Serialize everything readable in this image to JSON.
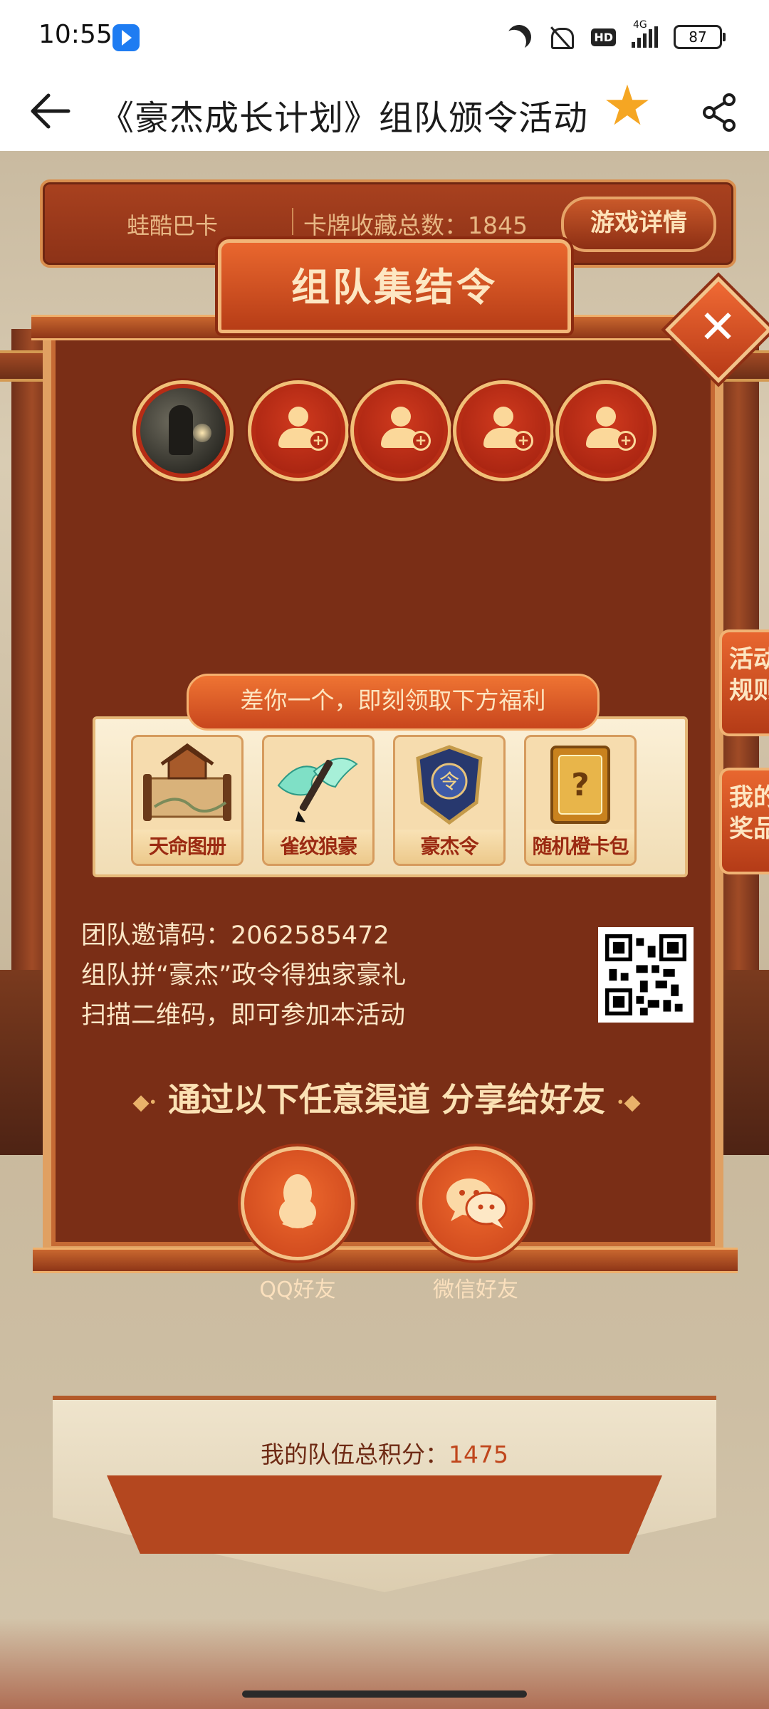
{
  "status_bar": {
    "time": "10:55",
    "network": "4G",
    "hd_badge": "HD",
    "battery": "87"
  },
  "header": {
    "title": "《豪杰成长计划》组队颁令活动",
    "icons": {
      "back": "back-arrow-icon",
      "favorite": "star-icon",
      "share": "share-icon"
    },
    "favorite_color": "#f5a623"
  },
  "info_bar": {
    "nickname": "蛙酷巴卡",
    "collection": "卡牌收藏总数：1845",
    "detail_button": "游戏详情"
  },
  "modal": {
    "title": "组队集结令",
    "close_icon": "close-x-icon",
    "members": [
      {
        "type": "avatar"
      },
      {
        "type": "add",
        "icon": "add-user-icon"
      },
      {
        "type": "add",
        "icon": "add-user-icon"
      },
      {
        "type": "add",
        "icon": "add-user-icon"
      },
      {
        "type": "add",
        "icon": "add-user-icon"
      }
    ],
    "rewards_banner": "差你一个，即刻领取下方福利",
    "rewards": [
      {
        "label": "天命图册",
        "icon": "scroll-book-icon"
      },
      {
        "label": "雀纹狼豪",
        "icon": "brush-icon"
      },
      {
        "label": "豪杰令",
        "icon": "token-shield-icon"
      },
      {
        "label": "随机橙卡包",
        "icon": "mystery-card-pack-icon"
      }
    ],
    "invite_code": "团队邀请码：2062585472",
    "invite_line2": "组队拼“豪杰”政令得独家豪礼",
    "invite_line3": "扫描二维码，即可参加本活动",
    "share_heading": "通过以下任意渠道 分享给好友",
    "share_options": [
      {
        "label": "QQ好友",
        "icon": "qq-icon"
      },
      {
        "label": "微信好友",
        "icon": "wechat-icon"
      }
    ]
  },
  "side_tabs": {
    "rules": [
      "活动",
      "规则"
    ],
    "prizes": [
      "我的",
      "奖品"
    ]
  },
  "team_score": {
    "label": "我的队伍总积分：",
    "value": "1475"
  },
  "colors": {
    "panel": "#7a2e16",
    "accent": "#e9672e",
    "gold": "#f1c078"
  }
}
